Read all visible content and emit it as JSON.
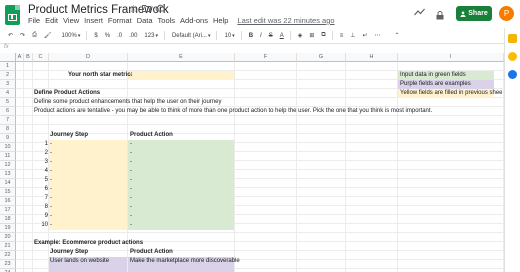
{
  "doc": {
    "title": "Product Metrics Framework"
  },
  "menu": {
    "items": [
      "File",
      "Edit",
      "View",
      "Insert",
      "Format",
      "Data",
      "Tools",
      "Add-ons",
      "Help"
    ],
    "last_edit": "Last edit was 22 minutes ago"
  },
  "share": {
    "label": "Share"
  },
  "user": {
    "initial": "P"
  },
  "toolbar": {
    "zoom": "100%",
    "currency": "$",
    "percent": "%",
    "decimals": ".0",
    "decimals2": ".00",
    "format": "123",
    "font": "Default (Ari...",
    "size": "10",
    "bold": "B",
    "italic": "I",
    "strike": "S",
    "textcolor": "A"
  },
  "formula": {
    "fx": "fx"
  },
  "columns": [
    "A",
    "B",
    "C",
    "D",
    "E",
    "F",
    "G",
    "H",
    "I"
  ],
  "rows": [
    "1",
    "2",
    "3",
    "4",
    "5",
    "6",
    "7",
    "8",
    "9",
    "10",
    "11",
    "12",
    "13",
    "14",
    "15",
    "16",
    "17",
    "18",
    "19",
    "20",
    "21",
    "22",
    "23",
    "24"
  ],
  "sheet": {
    "north_star_label": "Your north star metric:",
    "north_star_value": "-",
    "define_title": "Define Product Actions",
    "define_line1": "Define some product enhancements that help the user on their journey",
    "define_line2": "Product actions are tentative - you may be able to think of more than one product action to help the user. Pick the one that you think is most important.",
    "header_step": "Journey Step",
    "header_action": "Product Action",
    "steps": [
      "1",
      "2",
      "3",
      "4",
      "5",
      "6",
      "7",
      "8",
      "9",
      "10"
    ],
    "dash": "-",
    "example_title": "Example: Ecommerce product actions",
    "example_header_step": "Journey Step",
    "example_header_action": "Product Action",
    "example_step": "User lands on website",
    "example_action": "Make the marketplace more discoverable"
  },
  "legend": {
    "green": "Input data in green fields",
    "purple": "Purple fields are examples",
    "yellow": "Yellow fields are filled in previous shee"
  },
  "colors": {
    "green": "#d9ead3",
    "yellow": "#fff2cc",
    "purple": "#d9d2e9",
    "share": "#188038"
  }
}
